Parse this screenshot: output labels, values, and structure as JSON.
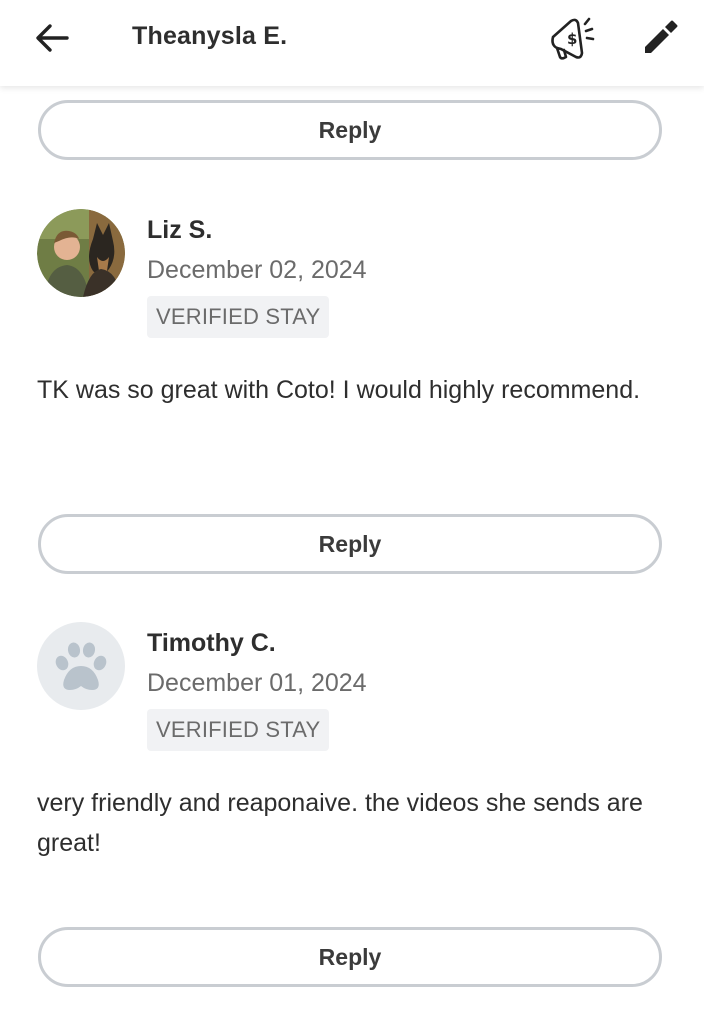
{
  "header": {
    "title": "Theanysla E.",
    "back_icon": "arrow-left-icon",
    "promo_icon": "megaphone-dollar-icon",
    "edit_icon": "pencil-icon"
  },
  "reply_label": "Reply",
  "reviews": [
    {
      "name": "Liz S.",
      "date": "December 02, 2024",
      "badge": "VERIFIED STAY",
      "text": "TK was so great with Coto! I would highly recommend.",
      "avatar": "photo"
    },
    {
      "name": "Timothy C.",
      "date": "December 01, 2024",
      "badge": "VERIFIED STAY",
      "text": "very friendly and reaponaive. the videos she sends are great!",
      "avatar": "paw-placeholder-icon"
    }
  ],
  "colors": {
    "border": "#c9cdd2",
    "badge_bg": "#f1f2f4",
    "muted_text": "#6b6b6b",
    "placeholder_avatar_bg": "#e8ebee",
    "paw": "#b9c3cc"
  }
}
